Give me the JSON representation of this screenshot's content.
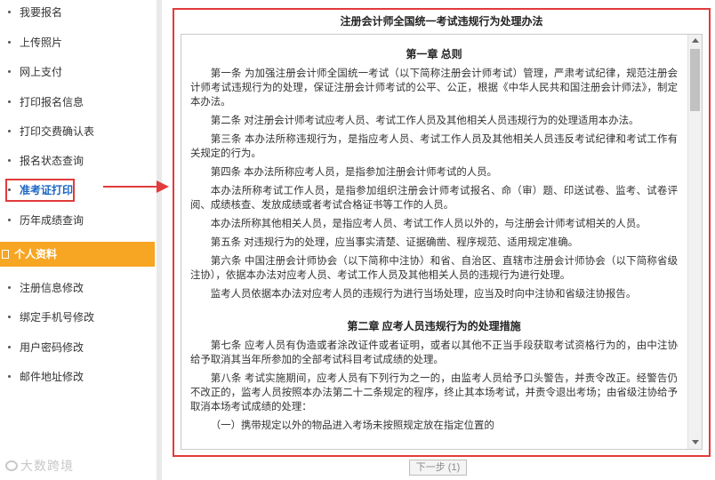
{
  "sidebar": {
    "items_top": [
      {
        "label": "我要报名"
      },
      {
        "label": "上传照片"
      },
      {
        "label": "网上支付"
      },
      {
        "label": "打印报名信息"
      },
      {
        "label": "打印交费确认表"
      },
      {
        "label": "报名状态查询"
      },
      {
        "label": "准考证打印",
        "active": true
      },
      {
        "label": "历年成绩查询"
      }
    ],
    "section_title": "个人资料",
    "items_bottom": [
      {
        "label": "注册信息修改"
      },
      {
        "label": "绑定手机号修改"
      },
      {
        "label": "用户密码修改"
      },
      {
        "label": "邮件地址修改"
      }
    ]
  },
  "document": {
    "title": "注册会计师全国统一考试违规行为处理办法",
    "chapter1": "第一章 总则",
    "paragraphs1": [
      "第一条 为加强注册会计师全国统一考试（以下简称注册会计师考试）管理，严肃考试纪律，规范注册会计师考试违规行为的处理，保证注册会计师考试的公平、公正，根据《中华人民共和国注册会计师法》，制定本办法。",
      "第二条 对注册会计师考试应考人员、考试工作人员及其他相关人员违规行为的处理适用本办法。",
      "第三条 本办法所称违规行为，是指应考人员、考试工作人员及其他相关人员违反考试纪律和考试工作有关规定的行为。",
      "第四条 本办法所称应考人员，是指参加注册会计师考试的人员。",
      "本办法所称考试工作人员，是指参加组织注册会计师考试报名、命（审）题、印送试卷、监考、试卷评阅、成绩核查、发放成绩或者考试合格证书等工作的人员。",
      "本办法所称其他相关人员，是指应考人员、考试工作人员以外的，与注册会计师考试相关的人员。",
      "第五条 对违规行为的处理，应当事实清楚、证据确凿、程序规范、适用规定准确。",
      "第六条 中国注册会计师协会（以下简称中注协）和省、自治区、直辖市注册会计师协会（以下简称省级注协），依据本办法对应考人员、考试工作人员及其他相关人员的违规行为进行处理。",
      "监考人员依据本办法对应考人员的违规行为进行当场处理，应当及时向中注协和省级注协报告。"
    ],
    "chapter2": "第二章 应考人员违规行为的处理措施",
    "paragraphs2": [
      "第七条 应考人员有伪造或者涂改证件或者证明，或者以其他不正当手段获取考试资格行为的，由中注协给予取消其当年所参加的全部考试科目考试成绩的处理。",
      "第八条 考试实施期间，应考人员有下列行为之一的，由监考人员给予口头警告，并责令改正。经警告仍不改正的，监考人员按照本办法第二十二条规定的程序，终止其本场考试，并责令退出考场；由省级注协给予取消本场考试成绩的处理：",
      "（一）携带规定以外的物品进入考场未按照规定放在指定位置的"
    ]
  },
  "next_button": "下一步 (1)",
  "watermark": "大数跨境",
  "colors": {
    "highlight_red": "#e23b3b",
    "section_orange": "#f6a623",
    "active_blue": "#1a66c4"
  }
}
